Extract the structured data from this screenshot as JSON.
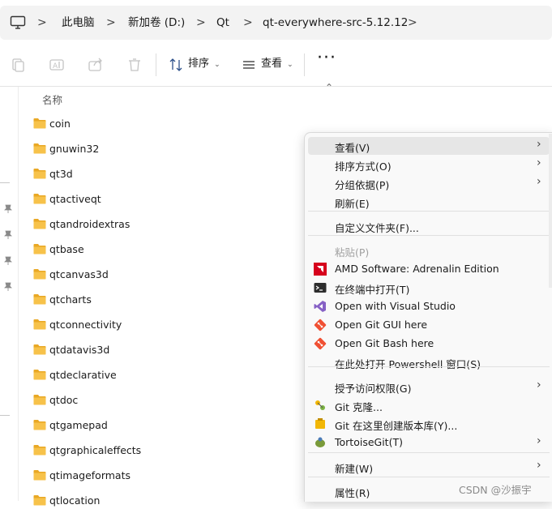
{
  "breadcrumb": {
    "items": [
      "此电脑",
      "新加卷 (D:)",
      "Qt",
      "qt-everywhere-src-5.12.12"
    ],
    "separator": ">"
  },
  "toolbar": {
    "sort_label": "排序",
    "view_label": "查看",
    "more_label": "···"
  },
  "list": {
    "column_name": "名称",
    "folders": [
      "coin",
      "gnuwin32",
      "qt3d",
      "qtactiveqt",
      "qtandroidextras",
      "qtbase",
      "qtcanvas3d",
      "qtcharts",
      "qtconnectivity",
      "qtdatavis3d",
      "qtdeclarative",
      "qtdoc",
      "qtgamepad",
      "qtgraphicaleffects",
      "qtimageformats",
      "qtlocation"
    ]
  },
  "context_menu": {
    "items": [
      {
        "label": "查看(V)",
        "submenu": true
      },
      {
        "label": "排序方式(O)",
        "submenu": true
      },
      {
        "label": "分组依据(P)",
        "submenu": true
      },
      {
        "label": "刷新(E)"
      },
      {
        "label": "自定义文件夹(F)..."
      },
      {
        "label": "粘贴(P)",
        "disabled": true
      },
      {
        "label": "AMD Software: Adrenalin Edition",
        "icon": "amd-icon"
      },
      {
        "label": "在终端中打开(T)",
        "icon": "terminal-icon"
      },
      {
        "label": "Open with Visual Studio",
        "icon": "visual-studio-icon"
      },
      {
        "label": "Open Git GUI here",
        "icon": "git-icon"
      },
      {
        "label": "Open Git Bash here",
        "icon": "git-icon"
      },
      {
        "label": "在此处打开 Powershell 窗口(S)"
      },
      {
        "label": "授予访问权限(G)",
        "submenu": true
      },
      {
        "label": "Git 克隆...",
        "icon": "tortoisegit-clone-icon"
      },
      {
        "label": "Git 在这里创建版本库(Y)...",
        "icon": "tortoisegit-create-icon"
      },
      {
        "label": "TortoiseGit(T)",
        "icon": "tortoisegit-icon",
        "submenu": true
      },
      {
        "label": "新建(W)",
        "submenu": true
      },
      {
        "label": "属性(R)"
      }
    ]
  },
  "watermark": "CSDN @沙振宇",
  "colors": {
    "folder": "#f7c24a",
    "amd": "#d6001c",
    "visual_studio": "#8661c5",
    "git": "#f05033",
    "hover": "#e6e6e6"
  }
}
